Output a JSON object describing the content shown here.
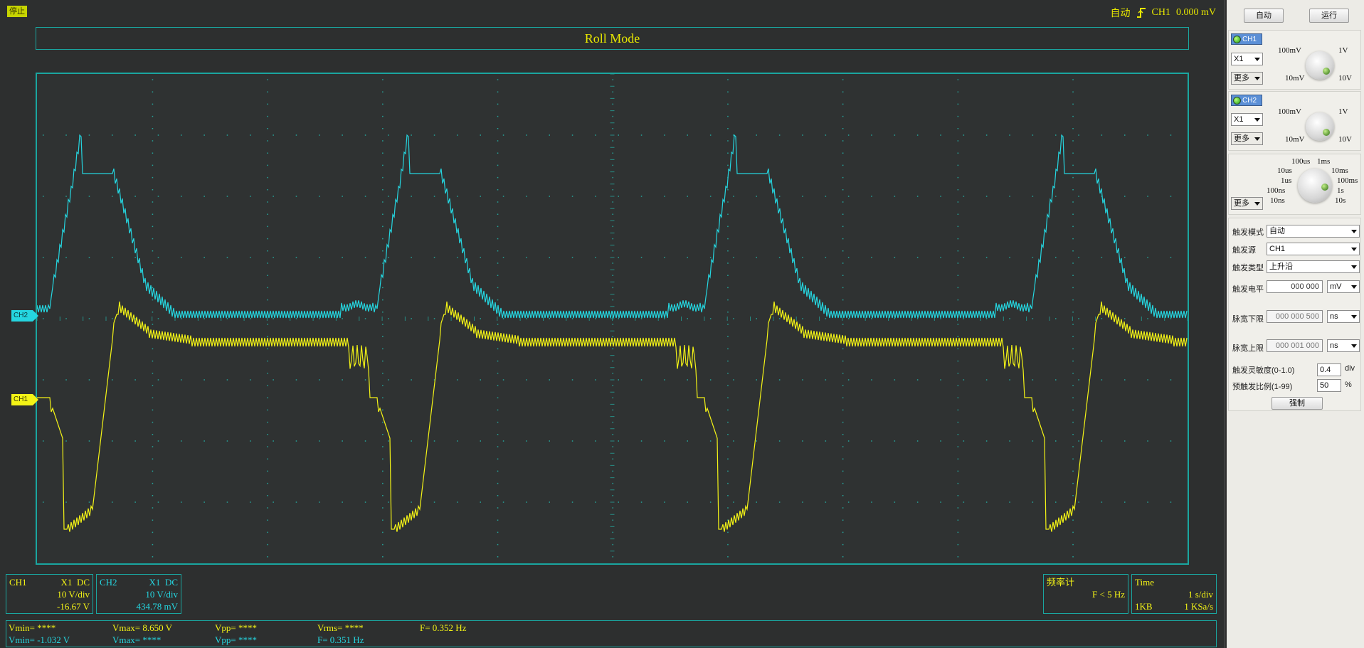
{
  "status": {
    "run_state_badge": "停止",
    "trigger_mode": "自动",
    "trigger_channel": "CH1",
    "trigger_value": "0.000 mV"
  },
  "banner": {
    "title": "Roll Mode"
  },
  "markers": {
    "ch2": "CH2",
    "ch1": "CH1"
  },
  "channel_info": {
    "ch1": {
      "name": "CH1",
      "probe": "X1",
      "coupling": "DC",
      "scale": "10 V/div",
      "offset": "-16.67 V"
    },
    "ch2": {
      "name": "CH2",
      "probe": "X1",
      "coupling": "DC",
      "scale": "10 V/div",
      "offset": "434.78 mV"
    }
  },
  "freq_counter": {
    "title": "频率计",
    "value": "F < 5 Hz"
  },
  "time_info": {
    "title": "Time",
    "scale": "1 s/div",
    "depth": "1KB",
    "rate": "1 KSa/s"
  },
  "measurements": {
    "ch1": {
      "vmin": "Vmin= ****",
      "vmax": "Vmax= 8.650 V",
      "vpp": "Vpp= ****",
      "vrms": "Vrms= ****",
      "freq": "F= 0.352 Hz"
    },
    "ch2": {
      "vmin": "Vmin= -1.032 V",
      "vmax": "Vmax= ****",
      "vpp": "Vpp= ****",
      "freq": "F= 0.351 Hz"
    }
  },
  "panel": {
    "auto_button": "自动",
    "run_button": "运行",
    "ch1": {
      "label": "CH1",
      "probe": "X1",
      "more": "更多",
      "knob": {
        "top_left": "100mV",
        "top_right": "1V",
        "bottom_left": "10mV",
        "bottom_right": "10V"
      }
    },
    "ch2": {
      "label": "CH2",
      "probe": "X1",
      "more": "更多",
      "knob": {
        "top_left": "100mV",
        "top_right": "1V",
        "bottom_left": "10mV",
        "bottom_right": "10V"
      }
    },
    "timebase": {
      "more": "更多",
      "labels": {
        "l_100us": "100us",
        "l_1ms": "1ms",
        "l_10us": "10us",
        "l_10ms": "10ms",
        "l_1us": "1us",
        "l_100ms": "100ms",
        "l_100ns": "100ns",
        "l_1s": "1s",
        "l_10ns": "10ns",
        "l_10s": "10s"
      }
    },
    "trigger": {
      "mode_label": "触发模式",
      "mode_value": "自动",
      "source_label": "触发源",
      "source_value": "CH1",
      "type_label": "触发类型",
      "type_value": "上升沿",
      "level_label": "触发电平",
      "level_value": "000 000",
      "level_unit": "mV",
      "pw_low_label": "脉宽下限",
      "pw_low_value": "000 000 500",
      "pw_low_unit": "ns",
      "pw_high_label": "脉宽上限",
      "pw_high_value": "000 001 000",
      "pw_high_unit": "ns",
      "sens_label": "触发灵敏度(0-1.0)",
      "sens_value": "0.4",
      "sens_unit": "div",
      "pre_label": "预触发比例(1-99)",
      "pre_value": "50",
      "pre_unit": "%",
      "force_button": "强制"
    }
  },
  "colors": {
    "ch1": "#f3f316",
    "ch2": "#25d6e0",
    "grid_border": "#1aa6a0",
    "screen_bg": "#2f3232"
  }
}
